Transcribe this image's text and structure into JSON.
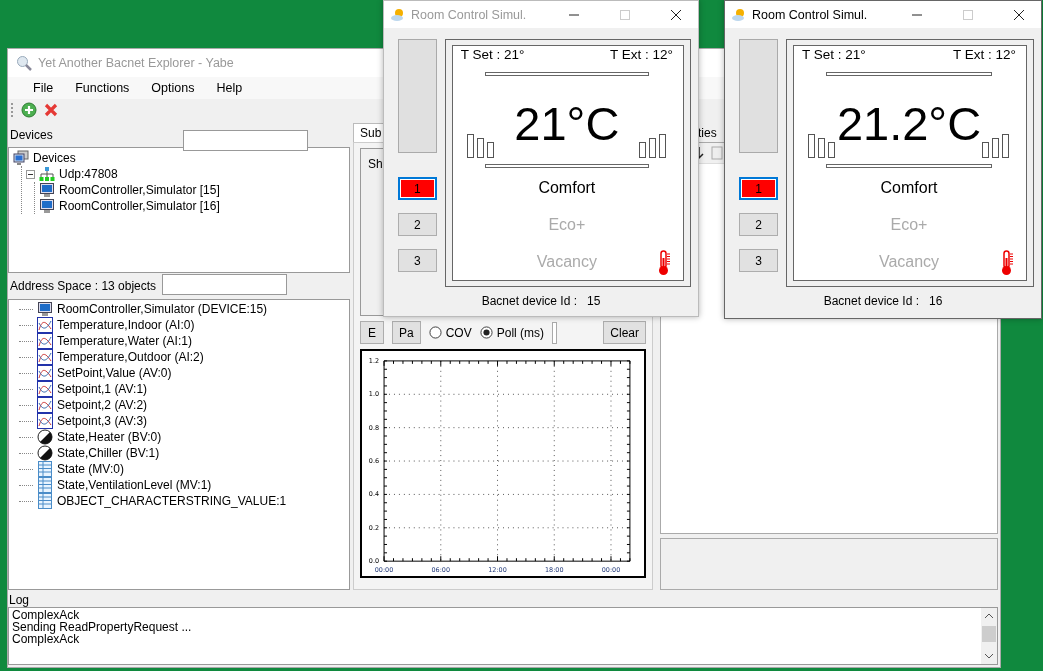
{
  "main_window": {
    "title": "Yet Another Bacnet Explorer - Yabe",
    "active": false,
    "menu": [
      "File",
      "Functions",
      "Options",
      "Help"
    ],
    "devices_panel": {
      "label": "Devices",
      "tree": [
        {
          "label": "Devices",
          "kind": "network-root",
          "children": [
            {
              "label": "Udp:47808",
              "kind": "port",
              "expanded": true,
              "children": [
                {
                  "label": "RoomController,Simulator [15]",
                  "kind": "device"
                },
                {
                  "label": "RoomController,Simulator [16]",
                  "kind": "device"
                }
              ]
            }
          ]
        }
      ]
    },
    "address_space": {
      "label": "Address Space : 13 objects",
      "items": [
        {
          "label": "RoomController,Simulator (DEVICE:15)",
          "kind": "device"
        },
        {
          "label": "Temperature,Indoor (AI:0)",
          "kind": "analog"
        },
        {
          "label": "Temperature,Water (AI:1)",
          "kind": "analog"
        },
        {
          "label": "Temperature,Outdoor (AI:2)",
          "kind": "analog"
        },
        {
          "label": "SetPoint,Value (AV:0)",
          "kind": "analog"
        },
        {
          "label": "Setpoint,1 (AV:1)",
          "kind": "analog"
        },
        {
          "label": "Setpoint,2 (AV:2)",
          "kind": "analog"
        },
        {
          "label": "Setpoint,3 (AV:3)",
          "kind": "analog"
        },
        {
          "label": "State,Heater (BV:0)",
          "kind": "binary"
        },
        {
          "label": "State,Chiller (BV:1)",
          "kind": "binary"
        },
        {
          "label": "State (MV:0)",
          "kind": "multistate"
        },
        {
          "label": "State,VentilationLevel (MV:1)",
          "kind": "multistate"
        },
        {
          "label": "OBJECT_CHARACTERSTRING_VALUE:1",
          "kind": "multistate"
        }
      ]
    },
    "subscriptions_panel": {
      "tab": "Sub",
      "group_label": "Sh",
      "buttons": [
        "E",
        "Pa"
      ],
      "modes": [
        {
          "label": "COV",
          "selected": false
        },
        {
          "label": "Poll (ms)",
          "selected": true
        }
      ],
      "clear_button": "Clear",
      "chart_data": {
        "type": "line",
        "grid": true,
        "xlim": [
          0,
          26
        ],
        "ylim": [
          0,
          1.2
        ],
        "xticks": [
          {
            "value": 0,
            "label": "00:00"
          },
          {
            "value": 6,
            "label": "06:00"
          },
          {
            "value": 12,
            "label": "12:00"
          },
          {
            "value": 18,
            "label": "18:00"
          },
          {
            "value": 24,
            "label": "00:00"
          }
        ],
        "yticks": [
          {
            "value": 0,
            "label": "0.0"
          },
          {
            "value": 0.2,
            "label": "0.2"
          },
          {
            "value": 0.4,
            "label": "0.4"
          },
          {
            "value": 0.6,
            "label": "0.6"
          },
          {
            "value": 0.8,
            "label": "0.8"
          },
          {
            "value": 1,
            "label": "1.0"
          },
          {
            "value": 1.2,
            "label": "1.2"
          }
        ]
      }
    },
    "properties_panel": {
      "tab": "ties"
    },
    "log": {
      "label": "Log",
      "lines": [
        "ComplexAck",
        "Sending ReadPropertyRequest ...",
        "ComplexAck"
      ]
    }
  },
  "room_windows": [
    {
      "title": "Room Control Simul.",
      "active": false,
      "setpoint": "T Set : 21°",
      "outdoor": "T Ext : 12°",
      "temperature": "21°C",
      "modes": [
        {
          "label": "Comfort",
          "selected": true
        },
        {
          "label": "Eco+",
          "selected": false
        },
        {
          "label": "Vacancy",
          "selected": false
        }
      ],
      "presets": [
        {
          "label": "1",
          "selected": true
        },
        {
          "label": "2",
          "selected": false
        },
        {
          "label": "3",
          "selected": false
        }
      ],
      "device_id_label": "Bacnet device Id :",
      "device_id": "15"
    },
    {
      "title": "Room Control Simul.",
      "active": true,
      "setpoint": "T Set : 21°",
      "outdoor": "T Ext : 12°",
      "temperature": "21.2°C",
      "modes": [
        {
          "label": "Comfort",
          "selected": true
        },
        {
          "label": "Eco+",
          "selected": false
        },
        {
          "label": "Vacancy",
          "selected": false
        }
      ],
      "presets": [
        {
          "label": "1",
          "selected": true
        },
        {
          "label": "2",
          "selected": false
        },
        {
          "label": "3",
          "selected": false
        }
      ],
      "device_id_label": "Bacnet device Id :",
      "device_id": "16"
    }
  ]
}
